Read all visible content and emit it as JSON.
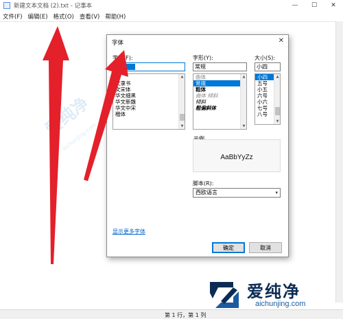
{
  "window": {
    "title": "新建文本文档 (2).txt - 记事本",
    "controls": {
      "minimize": "—",
      "maximize": "☐",
      "close": "✕"
    }
  },
  "menu": {
    "file": "文件(F)",
    "edit": "编辑(E)",
    "format": "格式(O)",
    "view": "查看(V)",
    "help": "帮助(H)"
  },
  "status": {
    "position": "第 1 行，第 1 列"
  },
  "dialog": {
    "title": "字体",
    "close": "✕",
    "font_label": "字体(F):",
    "font_value": "",
    "font_list": [
      "体",
      "文隶书",
      "文宋体",
      "华文细黑",
      "华文新魏",
      "华文中宋",
      "楷体"
    ],
    "style_label": "字形(Y):",
    "style_value": "常规",
    "style_list": [
      "曲体",
      "常规",
      "粗体",
      "曲体 倾斜",
      "倾斜",
      "粗偏斜体"
    ],
    "style_selected_index": 1,
    "size_label": "大小(S):",
    "size_value": "小四",
    "size_list": [
      "小四",
      "五号",
      "小五",
      "六号",
      "小六",
      "七号",
      "八号"
    ],
    "size_selected_index": 0,
    "sample_label": "示例",
    "sample_text": "AaBbYyZz",
    "script_label": "脚本(R):",
    "script_value": "西欧语言",
    "more_fonts_link": "显示更多字体",
    "ok": "确定",
    "cancel": "取消"
  },
  "watermark": {
    "name": "爱纯净",
    "url": "aichunjing.com"
  },
  "colors": {
    "arrow": "#e4202a",
    "selection": "#0078d7",
    "brand_dark": "#0c2b54",
    "brand_blue": "#1b5aa0"
  }
}
